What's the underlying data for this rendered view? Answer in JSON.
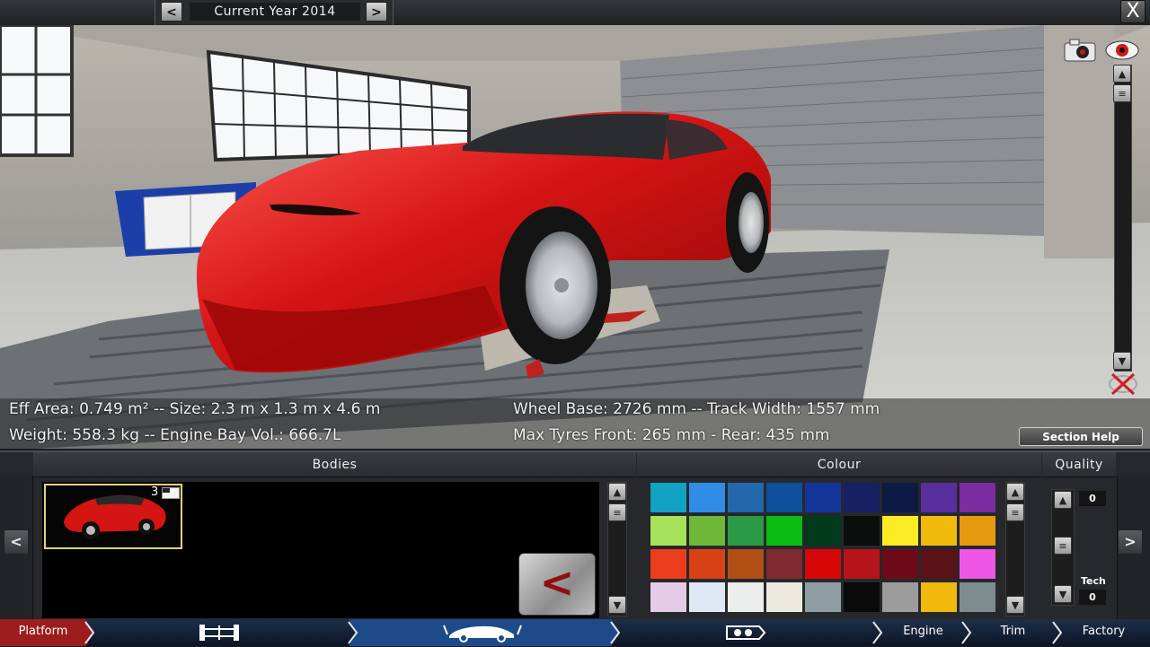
{
  "window": {
    "current_year": "Current Year 2014",
    "prev_year_glyph": "<",
    "next_year_glyph": ">",
    "close_glyph": "X"
  },
  "stats": {
    "eff_area": "Eff Area: 0.749 m² -- Size: 2.3 m x 1.3 m x 4.6 m",
    "weight": "Weight: 558.3 kg -- Engine Bay Vol.: 666.7L",
    "wheel_base": "Wheel Base: 2726 mm -- Track Width: 1557 mm",
    "tyres": "Max Tyres Front: 265 mm - Rear: 435 mm"
  },
  "section_help": "Section Help",
  "icons": {
    "camera": "camera-icon",
    "eye": "eye-icon",
    "reset_view": "reset-view-icon"
  },
  "panels": {
    "bodies_title": "Bodies",
    "colour_title": "Colour",
    "quality_title": "Quality",
    "body_item_count": "3",
    "back_glyph": "<",
    "quality_value": "0",
    "tech_label": "Tech",
    "tech_value": "0"
  },
  "colours": [
    "#11a2c4",
    "#2f8de6",
    "#2367ad",
    "#0f4f9c",
    "#14349a",
    "#182064",
    "#0d1a44",
    "#5a2f9d",
    "#7d2ba0",
    "#a6e35a",
    "#6fb83a",
    "#2b9a46",
    "#0bbd12",
    "#013a1c",
    "#0a0f0c",
    "#fbec24",
    "#f1bb0e",
    "#e59a12",
    "#ec3e1d",
    "#d94215",
    "#b04e13",
    "#7f2a2e",
    "#d70707",
    "#b5141a",
    "#6d0a1a",
    "#5b1216",
    "#ee57e6",
    "#e6cbe9",
    "#dfe9f5",
    "#eceeee",
    "#ece9df",
    "#8f9ea2",
    "#0a0a0a",
    "#9c9c9c",
    "#f0b90c",
    "#7f8c8f"
  ],
  "nav": {
    "platform": "Platform",
    "engine": "Engine",
    "trim": "Trim",
    "factory": "Factory"
  }
}
